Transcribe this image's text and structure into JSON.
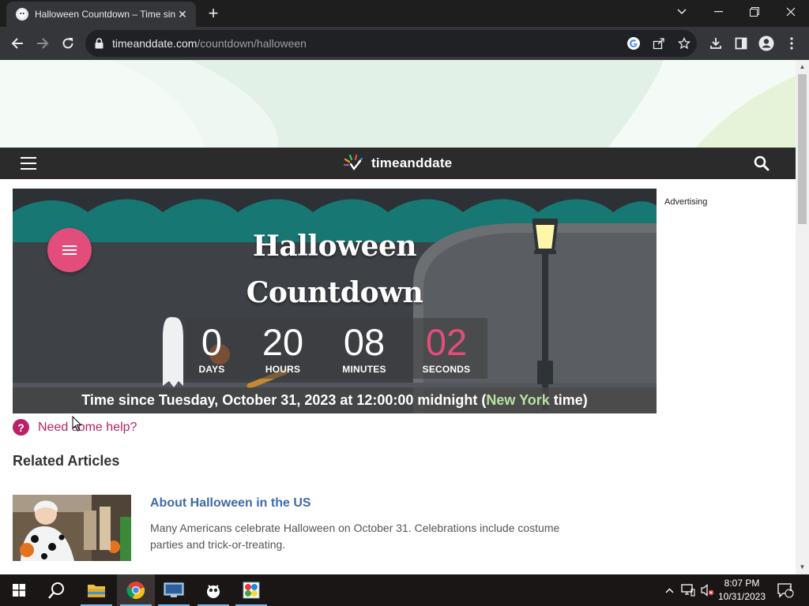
{
  "browser": {
    "tab_title": "Halloween Countdown – Time sin",
    "url_domain": "timeanddate.com",
    "url_path": "/countdown/halloween"
  },
  "site": {
    "logo_text": "timeanddate"
  },
  "countdown": {
    "title_line1": "Halloween",
    "title_line2": "Countdown",
    "days": "0",
    "days_label": "DAYS",
    "hours": "20",
    "hours_label": "HOURS",
    "minutes": "08",
    "minutes_label": "MINUTES",
    "seconds": "02",
    "seconds_label": "SECONDS",
    "caption_prefix": "Time since Tuesday, October 31, 2023 at 12:00:00 midnight (",
    "caption_city": "New York",
    "caption_suffix": " time)"
  },
  "sidebar": {
    "advertising_label": "Advertising"
  },
  "help": {
    "icon_text": "?",
    "link_text": "Need some help?"
  },
  "related": {
    "heading": "Related Articles",
    "articles": [
      {
        "title": "About Halloween in the US",
        "description": "Many Americans celebrate Halloween on October 31. Celebrations include costume parties and trick-or-treating."
      }
    ]
  },
  "taskbar": {
    "time": "8:07 PM",
    "date": "10/31/2023",
    "notification_count": "1"
  },
  "colors": {
    "accent_pink": "#e34d7c",
    "help_magenta": "#b72268",
    "link_blue": "#3f6aa8",
    "city_green": "#b7e3a3",
    "nav_dark": "#2b2b2b"
  },
  "icons": [
    "chrome-favicon-icon",
    "close-icon",
    "new-tab-icon",
    "back-icon",
    "forward-icon",
    "reload-icon",
    "lock-icon",
    "google-icon",
    "share-icon",
    "bookmark-star-icon",
    "download-icon",
    "side-panel-icon",
    "profile-icon",
    "kebab-menu-icon",
    "hamburger-icon",
    "search-icon",
    "help-icon",
    "windows-start-icon",
    "taskbar-search-icon",
    "file-explorer-icon",
    "chrome-icon"
  ]
}
